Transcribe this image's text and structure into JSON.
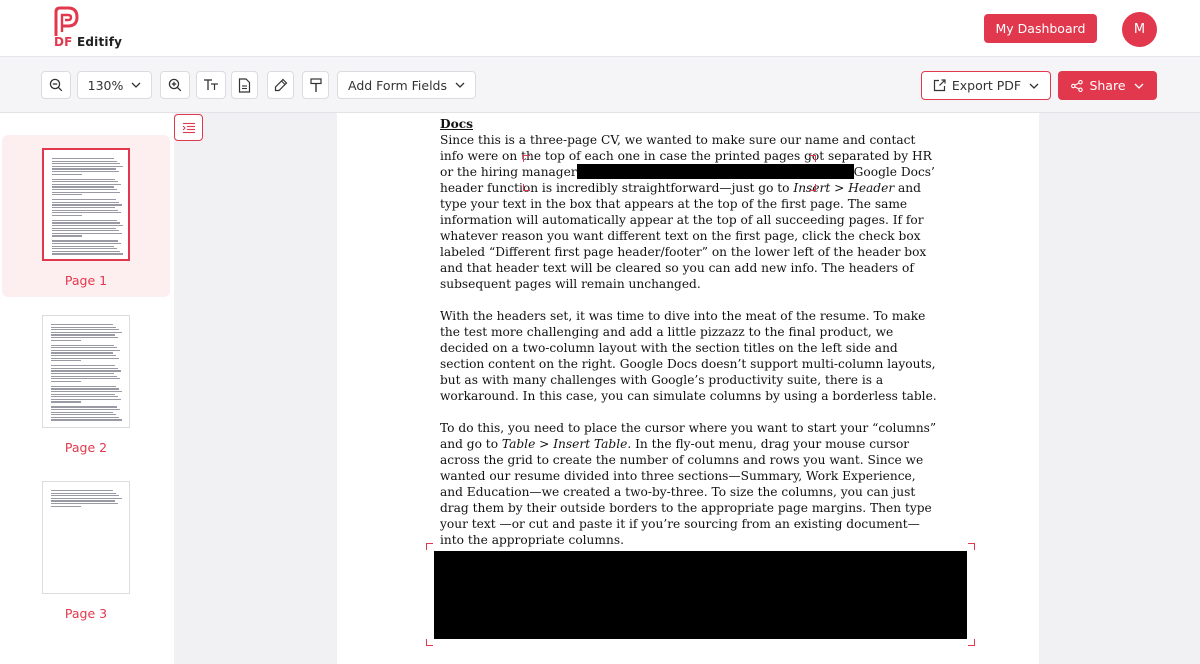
{
  "header": {
    "brand_prefix": "DF",
    "brand_name": "Editify",
    "dashboard_label": "My Dashboard",
    "avatar_initial": "M"
  },
  "toolbar": {
    "zoom_level": "130%",
    "form_fields_label": "Add Form Fields",
    "export_label": "Export PDF",
    "share_label": "Share"
  },
  "sidebar": {
    "pages": [
      {
        "label": "Page 1",
        "selected": true
      },
      {
        "label": "Page 2",
        "selected": false
      },
      {
        "label": "Page 3",
        "selected": false
      }
    ]
  },
  "document": {
    "heading": "Docs",
    "p1_a": "Since this is a three-page CV, we wanted to make sure our name and contact info were on the top of each one in case the printed pages got separated by HR or the hiring manager",
    "p1_b": "Google Docs’ header function is incredibly straightforward—just go to ",
    "p1_c": "Insert > Header",
    "p1_d": " and type your text in the box that appears at the top of the first page. The same information will automatically appear at the top of all succeeding pages. If for whatever reason you want different text on the first page, click the check box labeled “Different first page header/footer” on the lower left of the header box and that header text will be cleared so you can add new info. The headers of subsequent pages will remain unchanged.",
    "p2": "With the headers set, it was time to dive into the meat of the resume. To make the test more challenging and add a little pizzazz to the final product, we decided on a two-column layout with the section titles on the left side and section content on the right. Google Docs doesn’t support multi-column layouts, but as with many challenges with Google’s productivity suite, there is a workaround. In this case, you can simulate columns by using a borderless table.",
    "p3_a": "To do this, you need to place the cursor where you want to start your “columns” and go to ",
    "p3_b": "Table > Insert Table.",
    "p3_c": " In the fly-out menu, drag your mouse cursor across the grid to create the number of columns and rows you want. Since we wanted our resume divided into three sections—Summary, Work Experience, and Education—we created a two-by-three. To size the columns, you can just drag them by their outside borders to the appropriate page margins. Then type your text —or cut and paste it if you’re sourcing from an existing document—into the appropriate columns."
  },
  "colors": {
    "accent": "#e2384d",
    "active_bg": "#fdeff0"
  }
}
